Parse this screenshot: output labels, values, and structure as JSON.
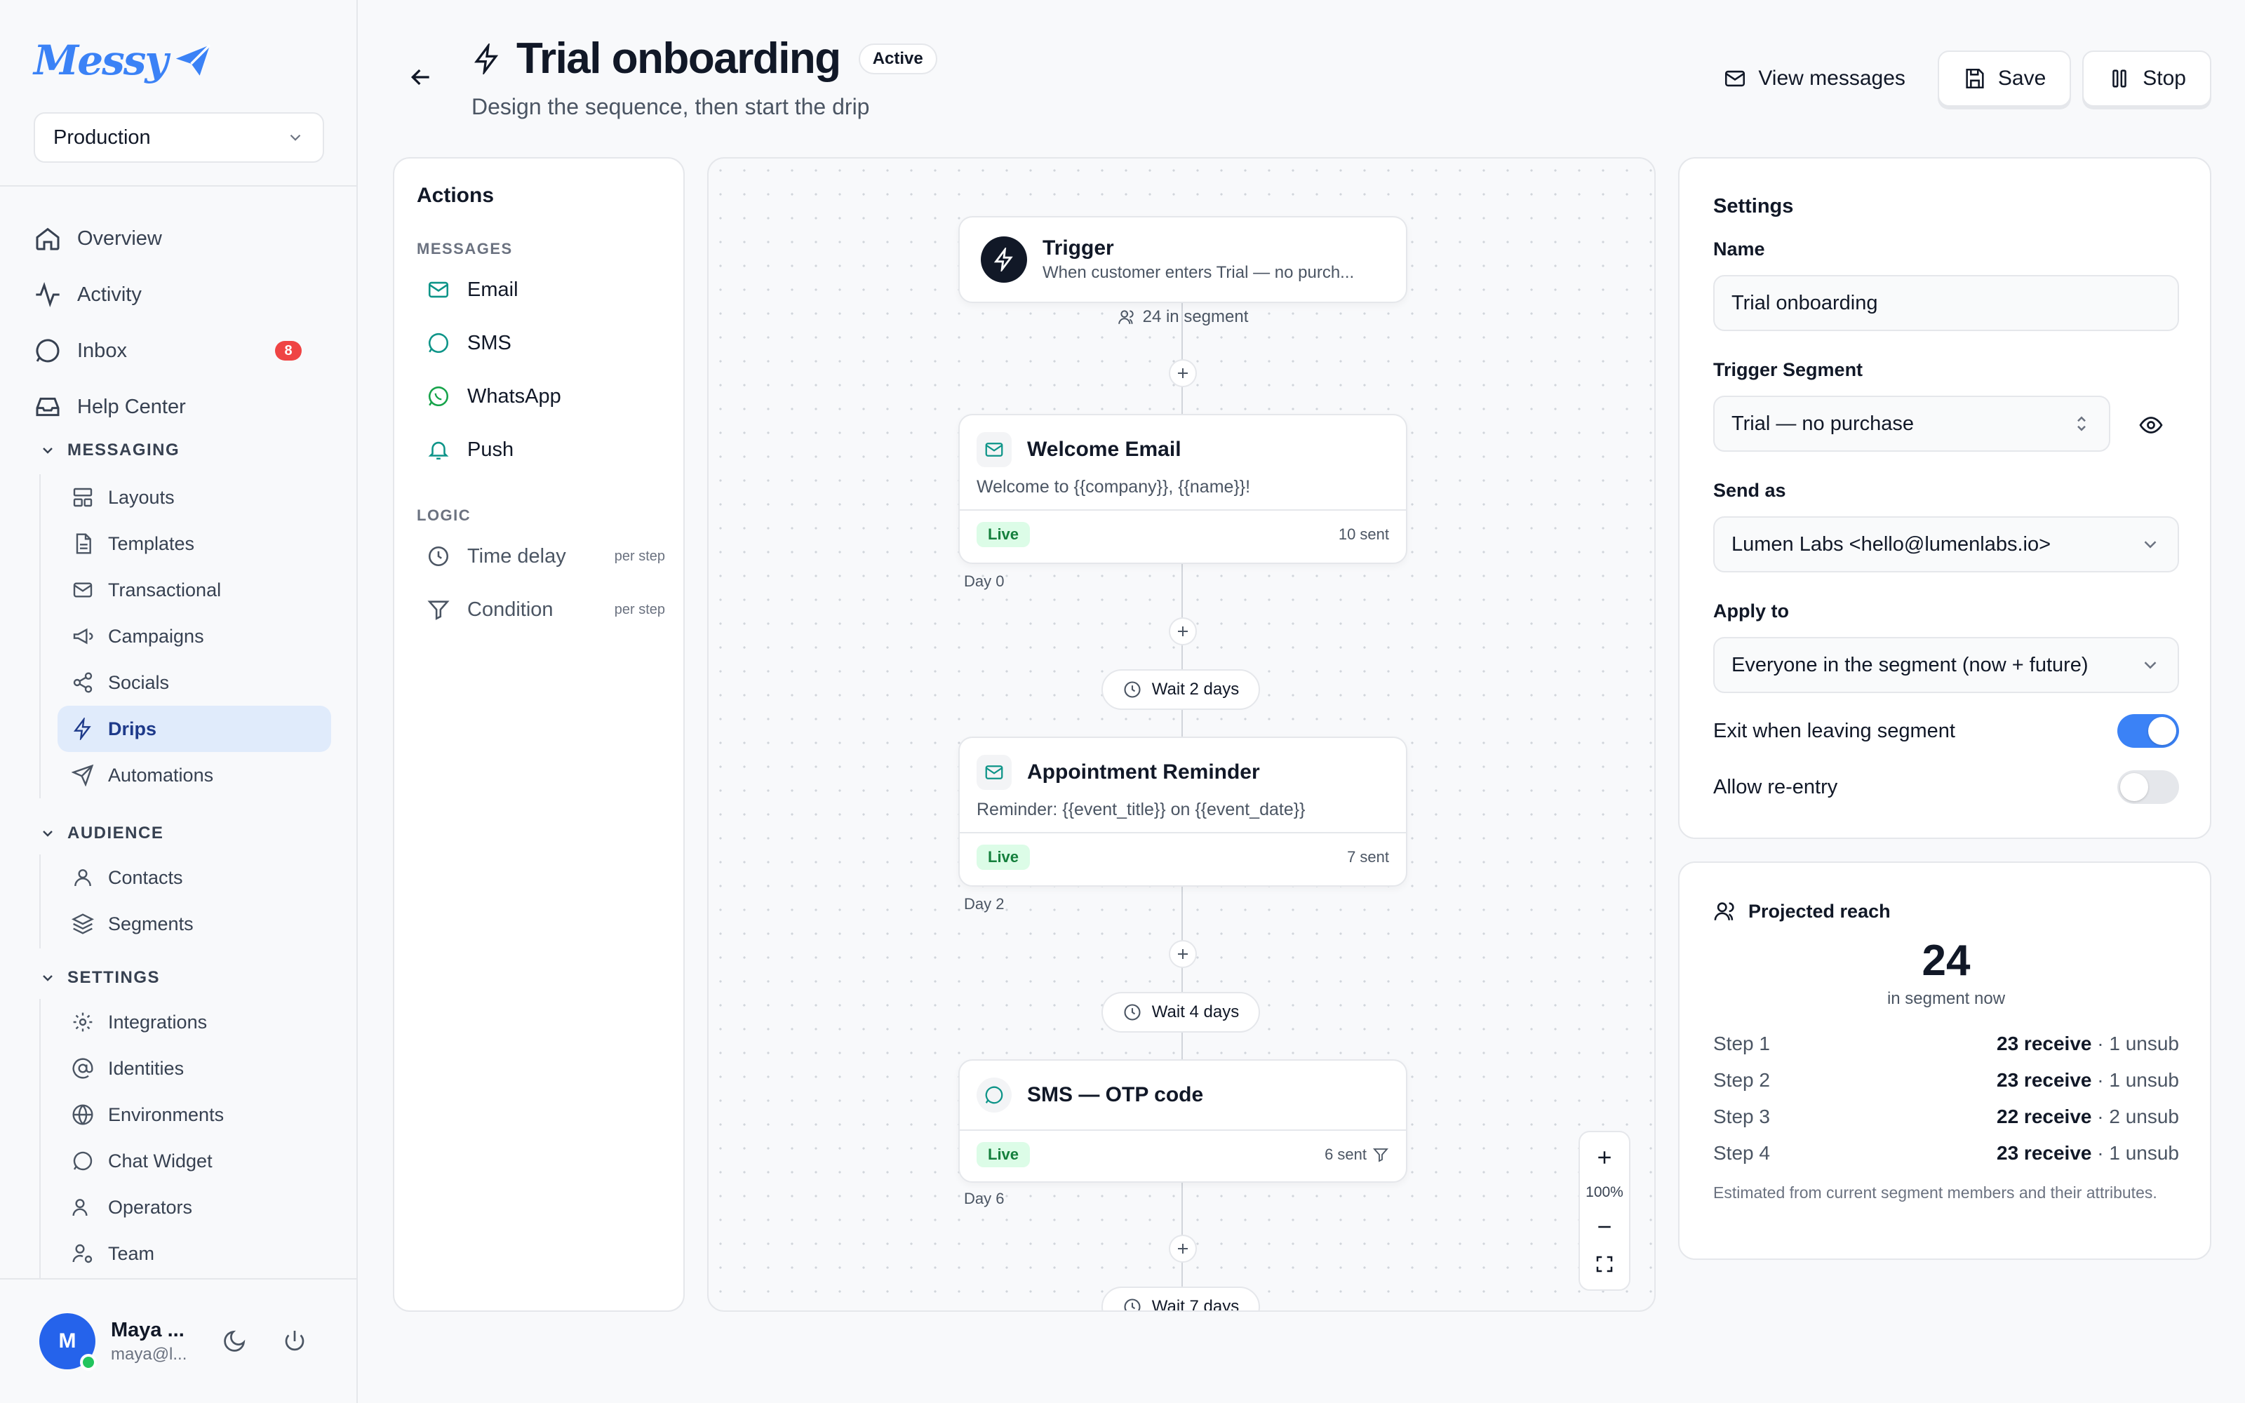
{
  "brand": {
    "name": "Messy"
  },
  "environment": {
    "selected": "Production"
  },
  "nav": {
    "main": [
      {
        "label": "Overview",
        "icon": "home-icon"
      },
      {
        "label": "Activity",
        "icon": "activity-icon"
      },
      {
        "label": "Inbox",
        "icon": "message-circle-icon",
        "badge": "8"
      },
      {
        "label": "Help Center",
        "icon": "inbox-tray-icon"
      }
    ],
    "messaging": {
      "title": "MESSAGING",
      "items": [
        "Layouts",
        "Templates",
        "Transactional",
        "Campaigns",
        "Socials",
        "Drips",
        "Automations"
      ],
      "active": "Drips"
    },
    "audience": {
      "title": "AUDIENCE",
      "items": [
        "Contacts",
        "Segments"
      ]
    },
    "settings": {
      "title": "SETTINGS",
      "items": [
        "Integrations",
        "Identities",
        "Environments",
        "Chat Widget",
        "Operators",
        "Team"
      ]
    }
  },
  "user": {
    "initial": "M",
    "name": "Maya ...",
    "email": "maya@l..."
  },
  "header": {
    "title": "Trial onboarding",
    "status": "Active",
    "subtitle": "Design the sequence, then start the drip",
    "view_messages": "View messages",
    "save": "Save",
    "stop": "Stop"
  },
  "actions": {
    "title": "Actions",
    "messages_label": "MESSAGES",
    "messages": [
      "Email",
      "SMS",
      "WhatsApp",
      "Push"
    ],
    "logic_label": "LOGIC",
    "logic": [
      {
        "label": "Time delay",
        "note": "per step"
      },
      {
        "label": "Condition",
        "note": "per step"
      }
    ]
  },
  "flow": {
    "trigger": {
      "title": "Trigger",
      "description": "When customer enters Trial — no purch...",
      "segment_count": "24 in segment"
    },
    "steps": [
      {
        "title": "Welcome Email",
        "preview": "Welcome to {{company}}, {{name}}!",
        "status": "Live",
        "sent": "10 sent",
        "day": "Day 0",
        "channel": "email"
      },
      {
        "wait": "Wait 2 days"
      },
      {
        "title": "Appointment Reminder",
        "preview": "Reminder: {{event_title}} on {{event_date}}",
        "status": "Live",
        "sent": "7 sent",
        "day": "Day 2",
        "channel": "email"
      },
      {
        "wait": "Wait 4 days"
      },
      {
        "title": "SMS — OTP code",
        "preview": "",
        "status": "Live",
        "sent": "6 sent",
        "day": "Day 6",
        "channel": "sms"
      },
      {
        "wait": "Wait 7 days"
      }
    ],
    "zoom": "100%"
  },
  "settings": {
    "title": "Settings",
    "name_label": "Name",
    "name_value": "Trial onboarding",
    "segment_label": "Trigger Segment",
    "segment_value": "Trial — no purchase",
    "send_as_label": "Send as",
    "send_as_value": "Lumen Labs <hello@lumenlabs.io>",
    "apply_label": "Apply to",
    "apply_value": "Everyone in the segment (now + future)",
    "exit_label": "Exit when leaving segment",
    "exit_on": true,
    "reentry_label": "Allow re-entry",
    "reentry_on": false
  },
  "reach": {
    "title": "Projected reach",
    "count": "24",
    "count_label": "in segment now",
    "rows": [
      {
        "step": "Step 1",
        "receive": "23 receive",
        "unsub": " · 1 unsub"
      },
      {
        "step": "Step 2",
        "receive": "23 receive",
        "unsub": " · 1 unsub"
      },
      {
        "step": "Step 3",
        "receive": "22 receive",
        "unsub": " · 2 unsub"
      },
      {
        "step": "Step 4",
        "receive": "23 receive",
        "unsub": " · 1 unsub"
      }
    ],
    "note": "Estimated from current segment members and their attributes."
  },
  "colors": {
    "accent": "#3b82f6",
    "live": "#15803d",
    "badge": "#ef4444",
    "active_nav": "#e0ebfb"
  }
}
